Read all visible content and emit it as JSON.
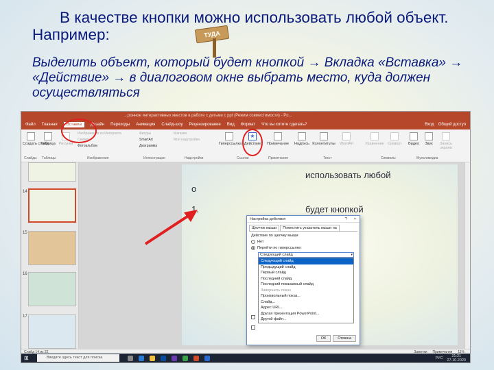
{
  "heading": {
    "line1": "В качестве кнопки можно использовать любой объект. Например:",
    "line2": "Выделить объект, который будет кнопкой → Вкладка «Вставка» → «Действие» → в диалоговом окне выбрать место, куда должен осуществляться"
  },
  "signpost_text": "ТУДА",
  "screenshot": {
    "window_title": "...ронное интерактивных квестов в работе с детьми с ppt (Режим совместимости) - Po...",
    "menu": [
      "Файл",
      "Главная",
      "Вставка",
      "Дизайн",
      "Переходы",
      "Анимация",
      "Слайд-шоу",
      "Рецензирование",
      "Вид",
      "Формат",
      "Что вы хотите сделать?"
    ],
    "menu_right": [
      "Вход",
      "Общий доступ"
    ],
    "ribbon": {
      "buttons": {
        "new_slide": "Создать слайд",
        "table": "Таблица",
        "pictures": "Рисунки",
        "online_pictures": "Изображения из Интернета",
        "screenshot": "Снимок",
        "photo_album": "Фотоальбом",
        "shapes": "Фигуры",
        "smartart": "SmartArt",
        "chart": "Диаграмма",
        "store": "Магазин",
        "my_addins": "Мои надстройки",
        "hyperlink": "Гиперссылка",
        "action": "Действие",
        "comment": "Примечание",
        "textbox": "Надпись",
        "header_footer": "Колонтитулы",
        "wordart": "WordArt",
        "equation": "Уравнение",
        "symbol": "Символ",
        "video": "Видео",
        "audio": "Звук",
        "screen_recording": "Запись экрана"
      },
      "groups": [
        "Слайды",
        "Таблицы",
        "Изображения",
        "Иллюстрации",
        "Надстройки",
        "Ссылки",
        "Примечания",
        "Текст",
        "Символы",
        "Мультимедиа"
      ]
    },
    "thumb_numbers": [
      "14",
      "15",
      "16",
      "17"
    ],
    "inner_slide": {
      "text1": "использовать любой",
      "text2": "о",
      "text3": "1.",
      "text4": "будет кнопкой"
    },
    "dialog": {
      "title": "Настройка действия",
      "title_buttons": [
        "?",
        "×"
      ],
      "tabs": [
        "Щелчок мыши",
        "Поместить указатель мыши на"
      ],
      "group_label": "Действие по щелчку мыши",
      "option_none": "Нет",
      "option_hyperlink": "Перейти по гиперссылке:",
      "combo_value": "Следующий слайд",
      "dropdown": [
        "Следующий слайд",
        "Предыдущий слайд",
        "Первый слайд",
        "Последний слайд",
        "Последний показанный слайд",
        "Завершить показ",
        "Произвольный показ...",
        "Слайд...",
        "Адрес URL...",
        "Другая презентация PowerPoint...",
        "Другой файл..."
      ],
      "buttons": [
        "ОК",
        "Отмена"
      ]
    },
    "statusbar": {
      "left": "Слайд 14 из 22",
      "notes": "Заметки",
      "comments": "Примечания",
      "zoom": "11%"
    },
    "taskbar": {
      "search": "Введите здесь текст для поиска",
      "lang": "РУС",
      "time": "21:21",
      "date": "27.10.2020"
    }
  },
  "colors": {
    "heading_text": "#0a1a7a",
    "ppt_accent": "#b7472a",
    "highlight_circle": "#e02020",
    "arrow": "#e02020"
  }
}
